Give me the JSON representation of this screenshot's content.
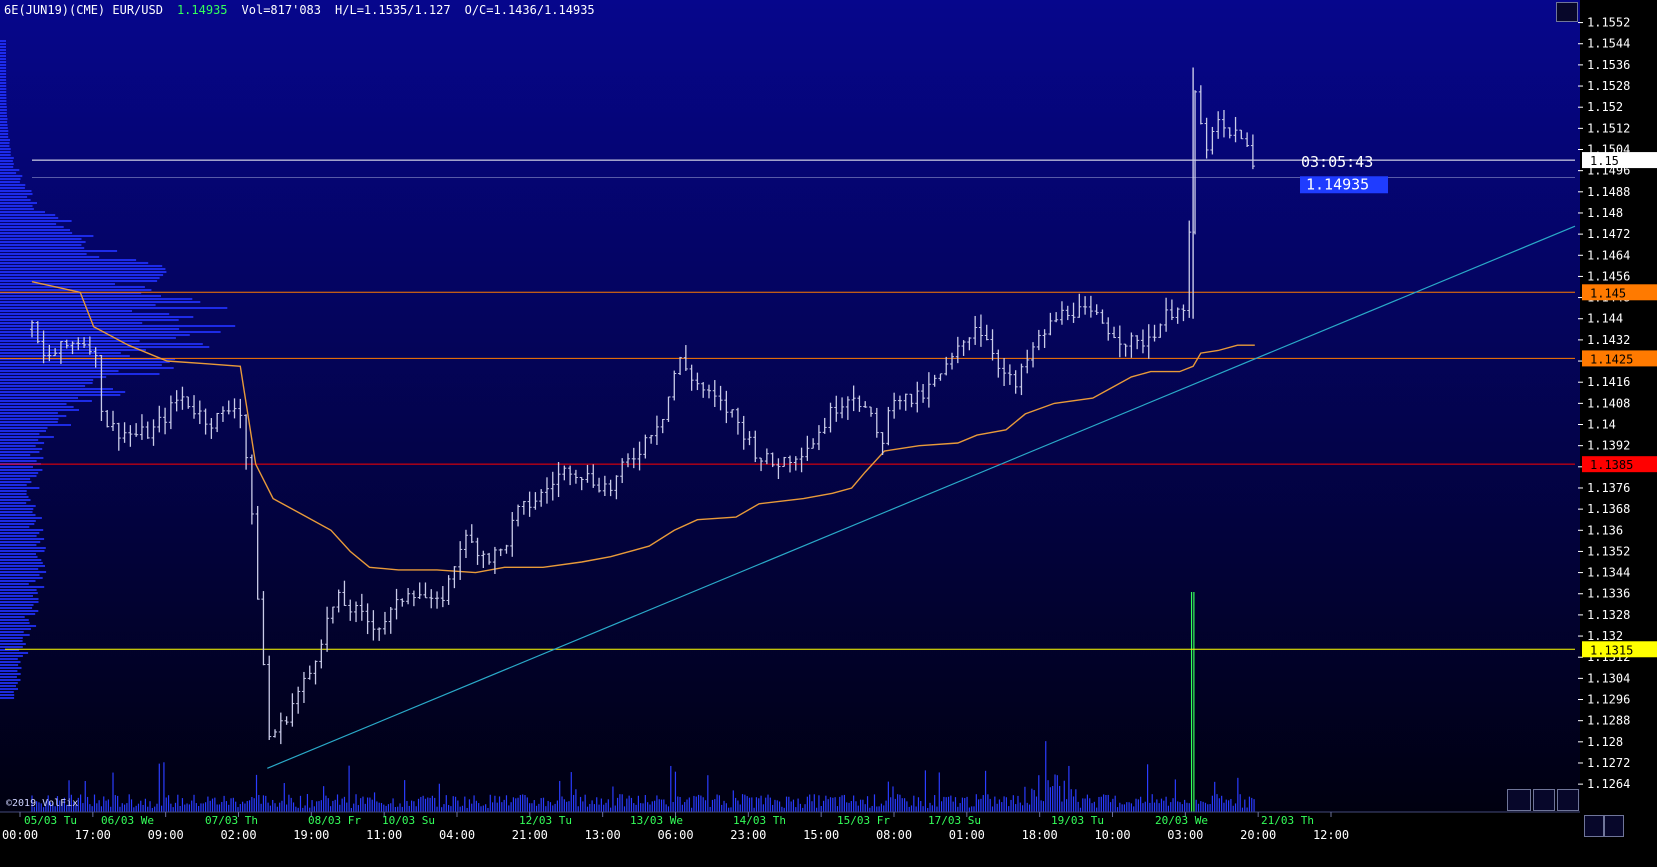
{
  "header": {
    "symbol": "6E(JUN19)(CME) EUR/USD",
    "last": "1.14935",
    "vol": "Vol=817'083",
    "hl": "H/L=1.1535/1.127",
    "oc": "O/C=1.1436/1.14935"
  },
  "copyright": "©2019 VolFix",
  "colors": {
    "bg_top": "#06068c",
    "bg_bottom": "#000010",
    "bars": "#c9cbe8",
    "vwap": "#e89a3a",
    "trend": "#2aa9c8",
    "green": "#34ff5a",
    "volume": "#2a3cff"
  },
  "chart_data": {
    "type": "bar",
    "title": "6E(JUN19)(CME) EUR/USD",
    "price_axis": {
      "ylim": [
        1.1258,
        1.1556
      ],
      "ticks": [
        "1.1552",
        "1.1544",
        "1.1536",
        "1.1528",
        "1.152",
        "1.1512",
        "1.1504",
        "1.1496",
        "1.1488",
        "1.148",
        "1.1472",
        "1.1464",
        "1.1456",
        "1.1448",
        "1.144",
        "1.1432",
        "1.1424",
        "1.1416",
        "1.1408",
        "1.14",
        "1.1392",
        "1.1384",
        "1.1376",
        "1.1368",
        "1.136",
        "1.1352",
        "1.1344",
        "1.1336",
        "1.1328",
        "1.132",
        "1.1312",
        "1.1304",
        "1.1296",
        "1.1288",
        "1.128",
        "1.1272",
        "1.1264"
      ]
    },
    "date_labels": [
      "05/03 Tu",
      "06/03 We",
      "07/03 Th",
      "08/03 Fr",
      "10/03 Su",
      "12/03 Tu",
      "13/03 We",
      "14/03 Th",
      "15/03 Fr",
      "17/03 Su",
      "19/03 Tu",
      "20/03 We",
      "21/03 Th"
    ],
    "time_labels": [
      "00:00",
      "17:00",
      "09:00",
      "02:00",
      "19:00",
      "11:00",
      "04:00",
      "21:00",
      "13:00",
      "06:00",
      "23:00",
      "15:00",
      "08:00",
      "01:00",
      "18:00",
      "10:00",
      "03:00",
      "20:00",
      "12:00"
    ],
    "levels": [
      {
        "label": "1.15",
        "price": 1.15,
        "color": "#ffffff",
        "text_color": "#000000"
      },
      {
        "label": "1.145",
        "price": 1.145,
        "color": "#ff7a00",
        "text_color": "#000000"
      },
      {
        "label": "1.1425",
        "price": 1.1425,
        "color": "#ff7a00",
        "text_color": "#000000"
      },
      {
        "label": "1.1385",
        "price": 1.1385,
        "color": "#ff0000",
        "text_color": "#000000"
      },
      {
        "label": "1.1315",
        "price": 1.1315,
        "color": "#ffff00",
        "text_color": "#000000"
      }
    ],
    "last_price": {
      "label": "1.14935",
      "price": 1.14935,
      "color": "#1f3cff"
    },
    "countdown": "03:05:43",
    "series": [
      {
        "name": "EUR/USD",
        "close": [
          [
            0,
            1.1436
          ],
          [
            0.6,
            1.1425
          ],
          [
            1.4,
            1.1428
          ],
          [
            2.4,
            1.1432
          ],
          [
            3.2,
            1.143
          ],
          [
            3.7,
            1.1402
          ],
          [
            4.3,
            1.1398
          ],
          [
            5.3,
            1.1396
          ],
          [
            6.2,
            1.1397
          ],
          [
            7.0,
            1.1404
          ],
          [
            7.7,
            1.1411
          ],
          [
            8.4,
            1.1406
          ],
          [
            9.2,
            1.1401
          ],
          [
            10.0,
            1.1404
          ],
          [
            10.7,
            1.141
          ],
          [
            11.2,
            1.1382
          ],
          [
            11.6,
            1.1345
          ],
          [
            11.9,
            1.1318
          ],
          [
            12.3,
            1.1282
          ],
          [
            12.9,
            1.1286
          ],
          [
            13.6,
            1.1296
          ],
          [
            14.4,
            1.1306
          ],
          [
            15.1,
            1.1322
          ],
          [
            15.8,
            1.1334
          ],
          [
            16.6,
            1.133
          ],
          [
            17.3,
            1.1326
          ],
          [
            18.0,
            1.1324
          ],
          [
            18.8,
            1.133
          ],
          [
            19.5,
            1.1338
          ],
          [
            20.2,
            1.1336
          ],
          [
            20.9,
            1.133
          ],
          [
            21.6,
            1.134
          ],
          [
            22.3,
            1.1357
          ],
          [
            23.0,
            1.1354
          ],
          [
            23.7,
            1.135
          ],
          [
            24.4,
            1.1352
          ],
          [
            25.1,
            1.1366
          ],
          [
            25.8,
            1.137
          ],
          [
            26.5,
            1.1374
          ],
          [
            27.2,
            1.138
          ],
          [
            27.9,
            1.1384
          ],
          [
            28.6,
            1.1381
          ],
          [
            29.3,
            1.1378
          ],
          [
            30.0,
            1.1376
          ],
          [
            30.7,
            1.1384
          ],
          [
            31.4,
            1.139
          ],
          [
            32.1,
            1.1398
          ],
          [
            32.8,
            1.1405
          ],
          [
            33.5,
            1.1425
          ],
          [
            34.2,
            1.1418
          ],
          [
            34.9,
            1.1412
          ],
          [
            35.6,
            1.1408
          ],
          [
            36.3,
            1.1404
          ],
          [
            37.0,
            1.1396
          ],
          [
            37.7,
            1.1388
          ],
          [
            38.4,
            1.1385
          ],
          [
            39.1,
            1.1387
          ],
          [
            39.8,
            1.139
          ],
          [
            40.5,
            1.1394
          ],
          [
            41.2,
            1.1402
          ],
          [
            41.9,
            1.1409
          ],
          [
            42.6,
            1.1412
          ],
          [
            43.3,
            1.1405
          ],
          [
            44.0,
            1.1392
          ],
          [
            44.7,
            1.1412
          ],
          [
            45.4,
            1.1409
          ],
          [
            46.1,
            1.141
          ],
          [
            46.8,
            1.1416
          ],
          [
            47.5,
            1.1422
          ],
          [
            48.2,
            1.143
          ],
          [
            48.9,
            1.1438
          ],
          [
            49.6,
            1.1432
          ],
          [
            50.3,
            1.142
          ],
          [
            51.0,
            1.1414
          ],
          [
            51.7,
            1.1426
          ],
          [
            52.4,
            1.1434
          ],
          [
            53.1,
            1.144
          ],
          [
            53.8,
            1.1444
          ],
          [
            54.5,
            1.1442
          ],
          [
            55.2,
            1.144
          ],
          [
            55.9,
            1.1436
          ],
          [
            56.6,
            1.1432
          ],
          [
            57.3,
            1.143
          ],
          [
            58.0,
            1.1434
          ],
          [
            58.7,
            1.144
          ],
          [
            59.4,
            1.1446
          ],
          [
            59.9,
            1.144
          ],
          [
            60.2,
            1.153
          ],
          [
            60.6,
            1.1512
          ],
          [
            61.0,
            1.1504
          ],
          [
            61.5,
            1.1514
          ],
          [
            62.0,
            1.1508
          ],
          [
            62.6,
            1.1512
          ],
          [
            63.1,
            1.1502
          ],
          [
            63.4,
            1.14935
          ]
        ]
      },
      {
        "name": "VWAP",
        "values": [
          [
            0,
            1.1454
          ],
          [
            2.5,
            1.145
          ],
          [
            3.2,
            1.1437
          ],
          [
            5,
            1.143
          ],
          [
            7,
            1.1424
          ],
          [
            9,
            1.1423
          ],
          [
            10.8,
            1.1422
          ],
          [
            11.6,
            1.1385
          ],
          [
            12.5,
            1.1372
          ],
          [
            14,
            1.1366
          ],
          [
            15.5,
            1.136
          ],
          [
            16.5,
            1.1352
          ],
          [
            17.5,
            1.1346
          ],
          [
            19,
            1.1345
          ],
          [
            21,
            1.1345
          ],
          [
            23,
            1.1344
          ],
          [
            24.5,
            1.1346
          ],
          [
            26.5,
            1.1346
          ],
          [
            28.5,
            1.1348
          ],
          [
            30,
            1.135
          ],
          [
            32,
            1.1354
          ],
          [
            33.3,
            1.136
          ],
          [
            34.5,
            1.1364
          ],
          [
            36.5,
            1.1365
          ],
          [
            37.7,
            1.137
          ],
          [
            40,
            1.1372
          ],
          [
            41.5,
            1.1374
          ],
          [
            42.5,
            1.1376
          ],
          [
            43.2,
            1.1382
          ],
          [
            44.2,
            1.139
          ],
          [
            46,
            1.1392
          ],
          [
            48,
            1.1393
          ],
          [
            49,
            1.1396
          ],
          [
            50.5,
            1.1398
          ],
          [
            51.5,
            1.1404
          ],
          [
            53,
            1.1408
          ],
          [
            55,
            1.141
          ],
          [
            56,
            1.1414
          ],
          [
            57,
            1.1418
          ],
          [
            58,
            1.142
          ],
          [
            59.5,
            1.142
          ],
          [
            60.2,
            1.1422
          ],
          [
            60.6,
            1.1427
          ],
          [
            61.5,
            1.1428
          ],
          [
            62.5,
            1.143
          ],
          [
            63.4,
            1.143
          ]
        ]
      },
      {
        "name": "trend",
        "values": [
          [
            12.2,
            1.127
          ],
          [
            80,
            1.1475
          ]
        ]
      }
    ]
  }
}
